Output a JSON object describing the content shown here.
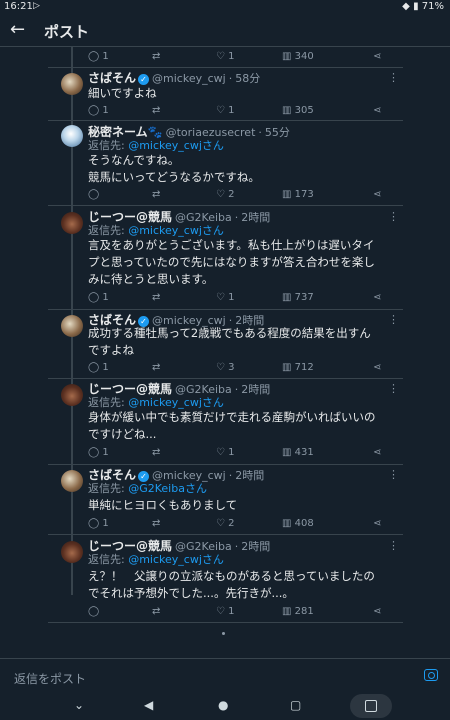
{
  "status": {
    "time": "16:21",
    "battery": "71%"
  },
  "header": {
    "title": "ポスト"
  },
  "top_actions": {
    "reply": "1",
    "like": "1",
    "views": "340"
  },
  "tweets": [
    {
      "name": "さばそん",
      "verified": true,
      "handle": "@mickey_cwj",
      "time": "58分",
      "reply_prefix": "",
      "reply_to": "",
      "lines": [
        "細いですよね"
      ],
      "replies": "1",
      "retweets": "",
      "likes": "1",
      "views": "305"
    },
    {
      "name": "秘密ネーム🐾",
      "verified": false,
      "handle": "@toriaezusecret",
      "time": "55分",
      "reply_prefix": "返信先: ",
      "reply_to": "@mickey_cwjさん",
      "lines": [
        "そうなんですね。",
        "競馬にいってどうなるかですね。"
      ],
      "replies": "",
      "retweets": "",
      "likes": "2",
      "views": "173"
    },
    {
      "name": "じーつー@競馬",
      "verified": false,
      "handle": "@G2Keiba",
      "time": "2時間",
      "reply_prefix": "返信先: ",
      "reply_to": "@mickey_cwjさん",
      "lines": [
        "言及をありがとうございます。私も仕上がりは遅いタイ",
        "プと思っていたので先にはなりますが答え合わせを楽し",
        "みに待とうと思います。"
      ],
      "replies": "1",
      "retweets": "",
      "likes": "1",
      "views": "737"
    },
    {
      "name": "さばそん",
      "verified": true,
      "handle": "@mickey_cwj",
      "time": "2時間",
      "reply_prefix": "",
      "reply_to": "",
      "lines": [
        "成功する種牡馬って2歳戦でもある程度の結果を出すん",
        "ですよね"
      ],
      "replies": "1",
      "retweets": "",
      "likes": "3",
      "views": "712"
    },
    {
      "name": "じーつー@競馬",
      "verified": false,
      "handle": "@G2Keiba",
      "time": "2時間",
      "reply_prefix": "返信先: ",
      "reply_to": "@mickey_cwjさん",
      "lines": [
        "身体が緩い中でも素質だけで走れる産駒がいればいいの",
        "ですけどね..."
      ],
      "replies": "1",
      "retweets": "",
      "likes": "1",
      "views": "431"
    },
    {
      "name": "さばそん",
      "verified": true,
      "handle": "@mickey_cwj",
      "time": "2時間",
      "reply_prefix": "返信先: ",
      "reply_to": "@G2Keibaさん",
      "lines": [
        "単純にヒヨロくもありまして"
      ],
      "replies": "1",
      "retweets": "",
      "likes": "2",
      "views": "408"
    },
    {
      "name": "じーつー@競馬",
      "verified": false,
      "handle": "@G2Keiba",
      "time": "2時間",
      "reply_prefix": "返信先: ",
      "reply_to": "@mickey_cwjさん",
      "lines": [
        "え？！　父譲りの立派なものがあると思っていましたの",
        "でそれは予想外でした...。先行きが...。"
      ],
      "replies": "",
      "retweets": "",
      "likes": "1",
      "views": "281"
    }
  ],
  "composer": {
    "placeholder": "返信をポスト"
  },
  "icons": {
    "back": "←",
    "reply": "◯",
    "retweet": "⇄",
    "like": "♡",
    "views": "▥",
    "share": "⋖",
    "more": "⋮",
    "nav_down": "⌄",
    "nav_back": "◀",
    "nav_home": "●",
    "nav_recent": "▢"
  }
}
